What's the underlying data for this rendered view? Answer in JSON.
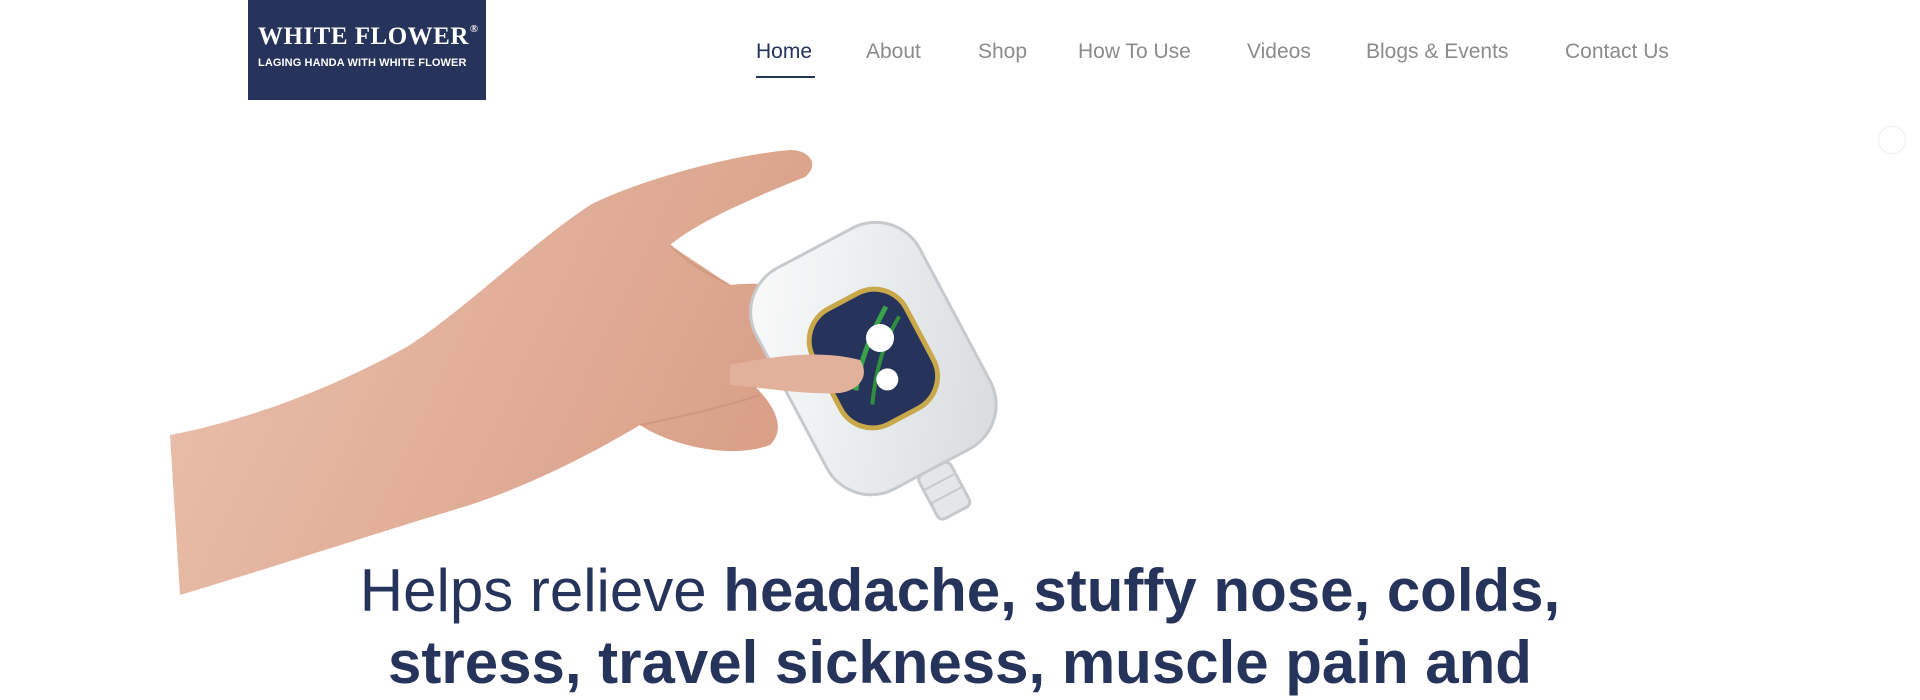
{
  "logo": {
    "title": "WHITE FLOWER",
    "registered": "®",
    "tagline": "LAGING HANDA WITH WHITE FLOWER",
    "background": "#26335a"
  },
  "nav": {
    "items": [
      {
        "label": "Home",
        "active": true
      },
      {
        "label": "About"
      },
      {
        "label": "Shop"
      },
      {
        "label": "How To Use"
      },
      {
        "label": "Videos"
      },
      {
        "label": "Blogs & Events"
      },
      {
        "label": "Contact Us"
      }
    ],
    "active_color": "#26335a",
    "inactive_color": "#8b8b8b"
  },
  "hero": {
    "image": "hand-holding-white-flower-bottle",
    "headline_light": "Helps relieve ",
    "headline_bold_line1": "headache, stuffy nose, colds,",
    "headline_bold_line2": "stress, travel sickness, muscle pain and",
    "text_color": "#26335a"
  }
}
